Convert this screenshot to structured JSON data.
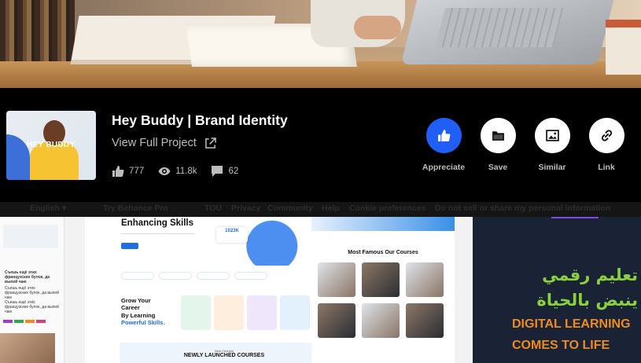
{
  "project": {
    "title": "Hey Buddy | Brand Identity",
    "view_full": "View Full Project",
    "thumbnail_text": "HEY BUDDY"
  },
  "stats": {
    "appreciations": "777",
    "views": "11.8k",
    "comments": "62"
  },
  "actions": [
    {
      "label": "Appreciate",
      "icon": "thumbs-up-icon",
      "color": "#1f5ff6"
    },
    {
      "label": "Save",
      "icon": "folder-icon"
    },
    {
      "label": "Similar",
      "icon": "image-icon"
    },
    {
      "label": "Link",
      "icon": "link-icon"
    }
  ],
  "footer": {
    "language": "English ▾",
    "try_pro": "Try Behance Pro",
    "links": [
      "TOU",
      "Privacy",
      "Community",
      "Help",
      "Cookie preferences",
      "Do not sell or share my personal information"
    ]
  },
  "gallery": {
    "panel_a": {
      "texts": [
        "Съешь ещё этих французских булок, да выпей чаю",
        "Съешь ещё этих французских булок, да выпей чаю",
        "Съешь ещё этих французских булок, да выпей чаю"
      ]
    },
    "panel_b": {
      "heading": "Enhancing Skills",
      "badge": "1023K",
      "grow_line1": "Grow Your",
      "grow_line2": "Career",
      "grow_line3": "By Learning",
      "grow_line4": "Powerful Skills.",
      "courses_title": "Most Famous Our Courses",
      "new_courses_small": "New Courses",
      "new_courses": "NEWLY LAUNCHED COURSES"
    },
    "panel_c": {
      "arabic_line1": "تعليم رقمي",
      "arabic_line2": "ينبض بالحياة",
      "english_line1": "DIGITAL LEARNING",
      "english_line2": "COMES TO LIFE"
    }
  },
  "colors": {
    "accent": "#1f5ff6",
    "arabic_green": "#8bd13d",
    "english_orange": "#f08a1f"
  }
}
